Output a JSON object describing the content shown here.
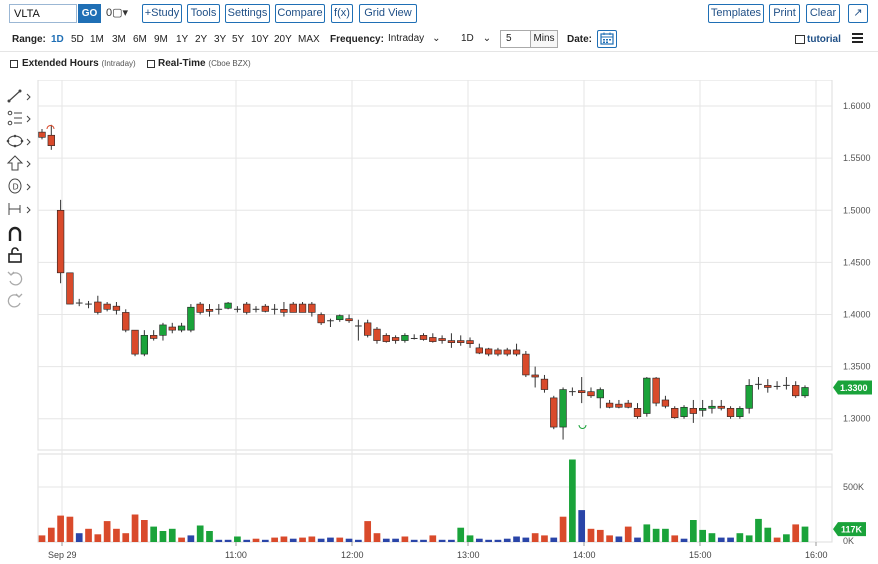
{
  "toolbar": {
    "symbol_value": "VLTA",
    "go_label": "GO",
    "dropdown_icon": "0▢▾",
    "study_label": "+Study",
    "tools_label": "Tools",
    "settings_label": "Settings",
    "compare_label": "Compare",
    "fx_label": "f(x)",
    "gridview_label": "Grid View",
    "templates_label": "Templates",
    "print_label": "Print",
    "clear_label": "Clear",
    "popout_icon": "↗"
  },
  "range_bar": {
    "range_label": "Range:",
    "ranges": [
      "1D",
      "5D",
      "1M",
      "3M",
      "6M",
      "9M",
      "1Y",
      "2Y",
      "3Y",
      "5Y",
      "10Y",
      "20Y",
      "MAX"
    ],
    "active_range": "1D",
    "frequency_label": "Frequency:",
    "frequency_value": "Intraday",
    "interval_value": "1D",
    "mins_value": "5",
    "mins_label": "Mins",
    "date_label": "Date:",
    "tutorial_label": "tutorial"
  },
  "options_bar": {
    "extended_label": "Extended Hours",
    "extended_sub": "(Intraday)",
    "realtime_label": "Real-Time",
    "realtime_sub": "(Cboe BZX)"
  },
  "side_tools": [
    "line-draw-icon",
    "fib-icon",
    "shape-icon",
    "arrow-icon",
    "annotation-icon",
    "measure-icon",
    "magnet-icon",
    "lock-icon",
    "undo-icon",
    "redo-icon"
  ],
  "colors": {
    "up": "#1aa33a",
    "down": "#d94a2b",
    "neutral_volume": "#2a45a8",
    "accent": "#1f6fb5"
  },
  "chart_data": {
    "type": "candlestick",
    "y_ticks": [
      "1.6000",
      "1.5500",
      "1.5000",
      "1.4500",
      "1.4000",
      "1.3500",
      "1.3000"
    ],
    "y_range": [
      1.27,
      1.625
    ],
    "x_ticks": [
      "Sep 29",
      "11:00",
      "12:00",
      "13:00",
      "14:00",
      "15:00",
      "16:00"
    ],
    "last_price": "1.3300",
    "volume_ticks": [
      "500K",
      "0K"
    ],
    "volume_range": [
      0,
      800
    ],
    "last_volume": "117K",
    "candles": [
      {
        "o": 1.575,
        "h": 1.578,
        "l": 1.568,
        "c": 1.57
      },
      {
        "o": 1.572,
        "h": 1.582,
        "l": 1.558,
        "c": 1.562
      },
      {
        "o": 1.5,
        "h": 1.51,
        "l": 1.43,
        "c": 1.44
      },
      {
        "o": 1.44,
        "h": 1.44,
        "l": 1.41,
        "c": 1.41
      },
      {
        "o": 1.41,
        "h": 1.415,
        "l": 1.408,
        "c": 1.411
      },
      {
        "o": 1.41,
        "h": 1.413,
        "l": 1.406,
        "c": 1.41
      },
      {
        "o": 1.412,
        "h": 1.418,
        "l": 1.4,
        "c": 1.402
      },
      {
        "o": 1.41,
        "h": 1.412,
        "l": 1.403,
        "c": 1.405
      },
      {
        "o": 1.408,
        "h": 1.412,
        "l": 1.4,
        "c": 1.404
      },
      {
        "o": 1.402,
        "h": 1.405,
        "l": 1.383,
        "c": 1.385
      },
      {
        "o": 1.385,
        "h": 1.385,
        "l": 1.36,
        "c": 1.362
      },
      {
        "o": 1.362,
        "h": 1.385,
        "l": 1.36,
        "c": 1.38
      },
      {
        "o": 1.38,
        "h": 1.385,
        "l": 1.375,
        "c": 1.377
      },
      {
        "o": 1.38,
        "h": 1.392,
        "l": 1.375,
        "c": 1.39
      },
      {
        "o": 1.388,
        "h": 1.392,
        "l": 1.382,
        "c": 1.385
      },
      {
        "o": 1.385,
        "h": 1.392,
        "l": 1.383,
        "c": 1.389
      },
      {
        "o": 1.385,
        "h": 1.41,
        "l": 1.383,
        "c": 1.407
      },
      {
        "o": 1.41,
        "h": 1.412,
        "l": 1.4,
        "c": 1.402
      },
      {
        "o": 1.405,
        "h": 1.41,
        "l": 1.398,
        "c": 1.403
      },
      {
        "o": 1.405,
        "h": 1.41,
        "l": 1.4,
        "c": 1.405
      },
      {
        "o": 1.406,
        "h": 1.412,
        "l": 1.405,
        "c": 1.411
      },
      {
        "o": 1.405,
        "h": 1.408,
        "l": 1.402,
        "c": 1.405
      },
      {
        "o": 1.41,
        "h": 1.412,
        "l": 1.4,
        "c": 1.402
      },
      {
        "o": 1.404,
        "h": 1.408,
        "l": 1.402,
        "c": 1.405
      },
      {
        "o": 1.408,
        "h": 1.41,
        "l": 1.402,
        "c": 1.403
      },
      {
        "o": 1.406,
        "h": 1.41,
        "l": 1.4,
        "c": 1.405
      },
      {
        "o": 1.405,
        "h": 1.412,
        "l": 1.398,
        "c": 1.402
      },
      {
        "o": 1.41,
        "h": 1.412,
        "l": 1.402,
        "c": 1.402
      },
      {
        "o": 1.41,
        "h": 1.412,
        "l": 1.402,
        "c": 1.402
      },
      {
        "o": 1.41,
        "h": 1.412,
        "l": 1.398,
        "c": 1.402
      },
      {
        "o": 1.4,
        "h": 1.402,
        "l": 1.39,
        "c": 1.392
      },
      {
        "o": 1.393,
        "h": 1.396,
        "l": 1.388,
        "c": 1.394
      },
      {
        "o": 1.395,
        "h": 1.4,
        "l": 1.393,
        "c": 1.399
      },
      {
        "o": 1.396,
        "h": 1.4,
        "l": 1.392,
        "c": 1.394
      },
      {
        "o": 1.39,
        "h": 1.395,
        "l": 1.375,
        "c": 1.389
      },
      {
        "o": 1.392,
        "h": 1.395,
        "l": 1.378,
        "c": 1.38
      },
      {
        "o": 1.386,
        "h": 1.388,
        "l": 1.372,
        "c": 1.375
      },
      {
        "o": 1.38,
        "h": 1.382,
        "l": 1.373,
        "c": 1.374
      },
      {
        "o": 1.378,
        "h": 1.38,
        "l": 1.372,
        "c": 1.375
      },
      {
        "o": 1.375,
        "h": 1.382,
        "l": 1.373,
        "c": 1.38
      },
      {
        "o": 1.378,
        "h": 1.381,
        "l": 1.376,
        "c": 1.377
      },
      {
        "o": 1.38,
        "h": 1.382,
        "l": 1.375,
        "c": 1.376
      },
      {
        "o": 1.378,
        "h": 1.382,
        "l": 1.373,
        "c": 1.374
      },
      {
        "o": 1.377,
        "h": 1.38,
        "l": 1.372,
        "c": 1.375
      },
      {
        "o": 1.375,
        "h": 1.382,
        "l": 1.368,
        "c": 1.373
      },
      {
        "o": 1.375,
        "h": 1.38,
        "l": 1.37,
        "c": 1.373
      },
      {
        "o": 1.375,
        "h": 1.378,
        "l": 1.368,
        "c": 1.372
      },
      {
        "o": 1.368,
        "h": 1.372,
        "l": 1.362,
        "c": 1.363
      },
      {
        "o": 1.367,
        "h": 1.368,
        "l": 1.36,
        "c": 1.362
      },
      {
        "o": 1.366,
        "h": 1.368,
        "l": 1.36,
        "c": 1.362
      },
      {
        "o": 1.366,
        "h": 1.368,
        "l": 1.36,
        "c": 1.362
      },
      {
        "o": 1.366,
        "h": 1.372,
        "l": 1.36,
        "c": 1.362
      },
      {
        "o": 1.362,
        "h": 1.365,
        "l": 1.34,
        "c": 1.342
      },
      {
        "o": 1.342,
        "h": 1.35,
        "l": 1.33,
        "c": 1.34
      },
      {
        "o": 1.338,
        "h": 1.342,
        "l": 1.325,
        "c": 1.328
      },
      {
        "o": 1.32,
        "h": 1.322,
        "l": 1.29,
        "c": 1.292
      },
      {
        "o": 1.292,
        "h": 1.33,
        "l": 1.28,
        "c": 1.328
      },
      {
        "o": 1.327,
        "h": 1.33,
        "l": 1.322,
        "c": 1.326
      },
      {
        "o": 1.327,
        "h": 1.34,
        "l": 1.315,
        "c": 1.325
      },
      {
        "o": 1.326,
        "h": 1.33,
        "l": 1.32,
        "c": 1.322
      },
      {
        "o": 1.32,
        "h": 1.33,
        "l": 1.31,
        "c": 1.328
      },
      {
        "o": 1.315,
        "h": 1.318,
        "l": 1.31,
        "c": 1.311
      },
      {
        "o": 1.314,
        "h": 1.318,
        "l": 1.31,
        "c": 1.311
      },
      {
        "o": 1.315,
        "h": 1.318,
        "l": 1.31,
        "c": 1.311
      },
      {
        "o": 1.31,
        "h": 1.315,
        "l": 1.3,
        "c": 1.302
      },
      {
        "o": 1.305,
        "h": 1.34,
        "l": 1.302,
        "c": 1.339
      },
      {
        "o": 1.339,
        "h": 1.34,
        "l": 1.312,
        "c": 1.315
      },
      {
        "o": 1.318,
        "h": 1.322,
        "l": 1.31,
        "c": 1.312
      },
      {
        "o": 1.31,
        "h": 1.312,
        "l": 1.3,
        "c": 1.301
      },
      {
        "o": 1.302,
        "h": 1.313,
        "l": 1.3,
        "c": 1.311
      },
      {
        "o": 1.31,
        "h": 1.318,
        "l": 1.296,
        "c": 1.305
      },
      {
        "o": 1.308,
        "h": 1.318,
        "l": 1.302,
        "c": 1.31
      },
      {
        "o": 1.31,
        "h": 1.318,
        "l": 1.305,
        "c": 1.312
      },
      {
        "o": 1.312,
        "h": 1.318,
        "l": 1.308,
        "c": 1.31
      },
      {
        "o": 1.31,
        "h": 1.312,
        "l": 1.3,
        "c": 1.302
      },
      {
        "o": 1.302,
        "h": 1.312,
        "l": 1.3,
        "c": 1.31
      },
      {
        "o": 1.31,
        "h": 1.338,
        "l": 1.305,
        "c": 1.332
      },
      {
        "o": 1.332,
        "h": 1.34,
        "l": 1.328,
        "c": 1.333
      },
      {
        "o": 1.332,
        "h": 1.338,
        "l": 1.325,
        "c": 1.33
      },
      {
        "o": 1.332,
        "h": 1.336,
        "l": 1.328,
        "c": 1.331
      },
      {
        "o": 1.333,
        "h": 1.34,
        "l": 1.328,
        "c": 1.332
      },
      {
        "o": 1.332,
        "h": 1.336,
        "l": 1.32,
        "c": 1.322
      },
      {
        "o": 1.322,
        "h": 1.332,
        "l": 1.32,
        "c": 1.33
      }
    ],
    "volumes": [
      {
        "v": 60,
        "d": "down"
      },
      {
        "v": 130,
        "d": "down"
      },
      {
        "v": 240,
        "d": "down"
      },
      {
        "v": 230,
        "d": "down"
      },
      {
        "v": 80,
        "d": "neutral"
      },
      {
        "v": 120,
        "d": "down"
      },
      {
        "v": 70,
        "d": "down"
      },
      {
        "v": 190,
        "d": "down"
      },
      {
        "v": 120,
        "d": "down"
      },
      {
        "v": 80,
        "d": "down"
      },
      {
        "v": 250,
        "d": "down"
      },
      {
        "v": 200,
        "d": "down"
      },
      {
        "v": 140,
        "d": "up"
      },
      {
        "v": 100,
        "d": "up"
      },
      {
        "v": 120,
        "d": "up"
      },
      {
        "v": 40,
        "d": "down"
      },
      {
        "v": 60,
        "d": "neutral"
      },
      {
        "v": 150,
        "d": "up"
      },
      {
        "v": 100,
        "d": "up"
      },
      {
        "v": 20,
        "d": "neutral"
      },
      {
        "v": 20,
        "d": "neutral"
      },
      {
        "v": 50,
        "d": "up"
      },
      {
        "v": 20,
        "d": "neutral"
      },
      {
        "v": 30,
        "d": "down"
      },
      {
        "v": 20,
        "d": "neutral"
      },
      {
        "v": 40,
        "d": "down"
      },
      {
        "v": 50,
        "d": "down"
      },
      {
        "v": 30,
        "d": "neutral"
      },
      {
        "v": 40,
        "d": "down"
      },
      {
        "v": 50,
        "d": "down"
      },
      {
        "v": 30,
        "d": "neutral"
      },
      {
        "v": 40,
        "d": "neutral"
      },
      {
        "v": 40,
        "d": "down"
      },
      {
        "v": 30,
        "d": "neutral"
      },
      {
        "v": 20,
        "d": "neutral"
      },
      {
        "v": 190,
        "d": "down"
      },
      {
        "v": 80,
        "d": "down"
      },
      {
        "v": 30,
        "d": "neutral"
      },
      {
        "v": 30,
        "d": "neutral"
      },
      {
        "v": 50,
        "d": "down"
      },
      {
        "v": 20,
        "d": "neutral"
      },
      {
        "v": 20,
        "d": "neutral"
      },
      {
        "v": 60,
        "d": "down"
      },
      {
        "v": 20,
        "d": "neutral"
      },
      {
        "v": 20,
        "d": "neutral"
      },
      {
        "v": 130,
        "d": "up"
      },
      {
        "v": 60,
        "d": "up"
      },
      {
        "v": 30,
        "d": "neutral"
      },
      {
        "v": 20,
        "d": "neutral"
      },
      {
        "v": 20,
        "d": "neutral"
      },
      {
        "v": 30,
        "d": "neutral"
      },
      {
        "v": 50,
        "d": "neutral"
      },
      {
        "v": 40,
        "d": "neutral"
      },
      {
        "v": 80,
        "d": "down"
      },
      {
        "v": 60,
        "d": "down"
      },
      {
        "v": 40,
        "d": "neutral"
      },
      {
        "v": 230,
        "d": "down"
      },
      {
        "v": 750,
        "d": "up"
      },
      {
        "v": 290,
        "d": "neutral"
      },
      {
        "v": 120,
        "d": "down"
      },
      {
        "v": 110,
        "d": "down"
      },
      {
        "v": 60,
        "d": "down"
      },
      {
        "v": 50,
        "d": "neutral"
      },
      {
        "v": 140,
        "d": "down"
      },
      {
        "v": 40,
        "d": "neutral"
      },
      {
        "v": 160,
        "d": "up"
      },
      {
        "v": 120,
        "d": "up"
      },
      {
        "v": 120,
        "d": "up"
      },
      {
        "v": 60,
        "d": "down"
      },
      {
        "v": 30,
        "d": "neutral"
      },
      {
        "v": 200,
        "d": "up"
      },
      {
        "v": 110,
        "d": "up"
      },
      {
        "v": 80,
        "d": "up"
      },
      {
        "v": 40,
        "d": "neutral"
      },
      {
        "v": 40,
        "d": "neutral"
      },
      {
        "v": 80,
        "d": "up"
      },
      {
        "v": 60,
        "d": "up"
      },
      {
        "v": 210,
        "d": "up"
      },
      {
        "v": 130,
        "d": "up"
      },
      {
        "v": 40,
        "d": "down"
      },
      {
        "v": 70,
        "d": "up"
      },
      {
        "v": 160,
        "d": "down"
      },
      {
        "v": 140,
        "d": "up"
      }
    ]
  }
}
